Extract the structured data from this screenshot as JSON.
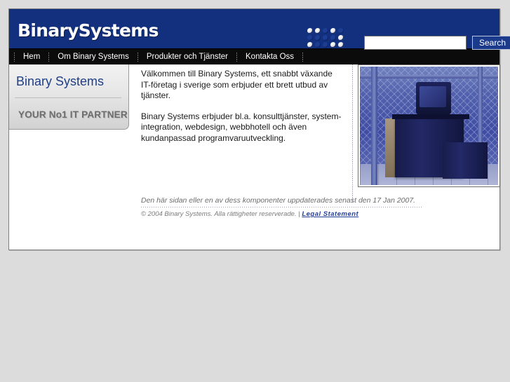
{
  "header": {
    "brand": "BinarySystems",
    "dot_matrix_icon": "dot-matrix-icon",
    "dot_matrix_pattern": [
      [
        1,
        1,
        0,
        1,
        0
      ],
      [
        0,
        0,
        0,
        0,
        1
      ],
      [
        1,
        0,
        0,
        1,
        1
      ]
    ],
    "search": {
      "value": "",
      "placeholder": "",
      "button_label": "Search"
    },
    "background_color": "#12307e"
  },
  "nav": {
    "items": [
      {
        "label": "Hem"
      },
      {
        "label": "Om Binary Systems"
      },
      {
        "label": "Produkter och Tjänster"
      },
      {
        "label": "Kontakta Oss"
      }
    ],
    "background_color": "#0b0b0b"
  },
  "sidebar": {
    "title": "Binary Systems",
    "tagline": "YOUR No1 IT PARTNER",
    "title_color": "#1f3f86",
    "tagline_color": "#6d6d6d"
  },
  "main": {
    "paragraphs": [
      "Välkommen till Binary Systems, ett snabbt växande IT-företag i sverige som erbjuder ett brett utbud av tjänster.",
      "Binary Systems erbjuder bl.a. konsulttjänster, system-integration, webdesign, webbhotell och även kundanpassad programvaruutveckling."
    ]
  },
  "photo": {
    "alt": "server-room-photo",
    "description": "Blue tinted photograph of server cabinets and a CRT monitor behind a chain-link fence enclosure"
  },
  "footer": {
    "updated_text": "Den här sidan eller en av dess komponenter uppdaterades senast den 17 Jan 2007.",
    "copyright_text": "© 2004 Binary Systems. Alla rättigheter reserverade. |",
    "legal_link_label": "Legal Statement",
    "link_color": "#27409b"
  }
}
